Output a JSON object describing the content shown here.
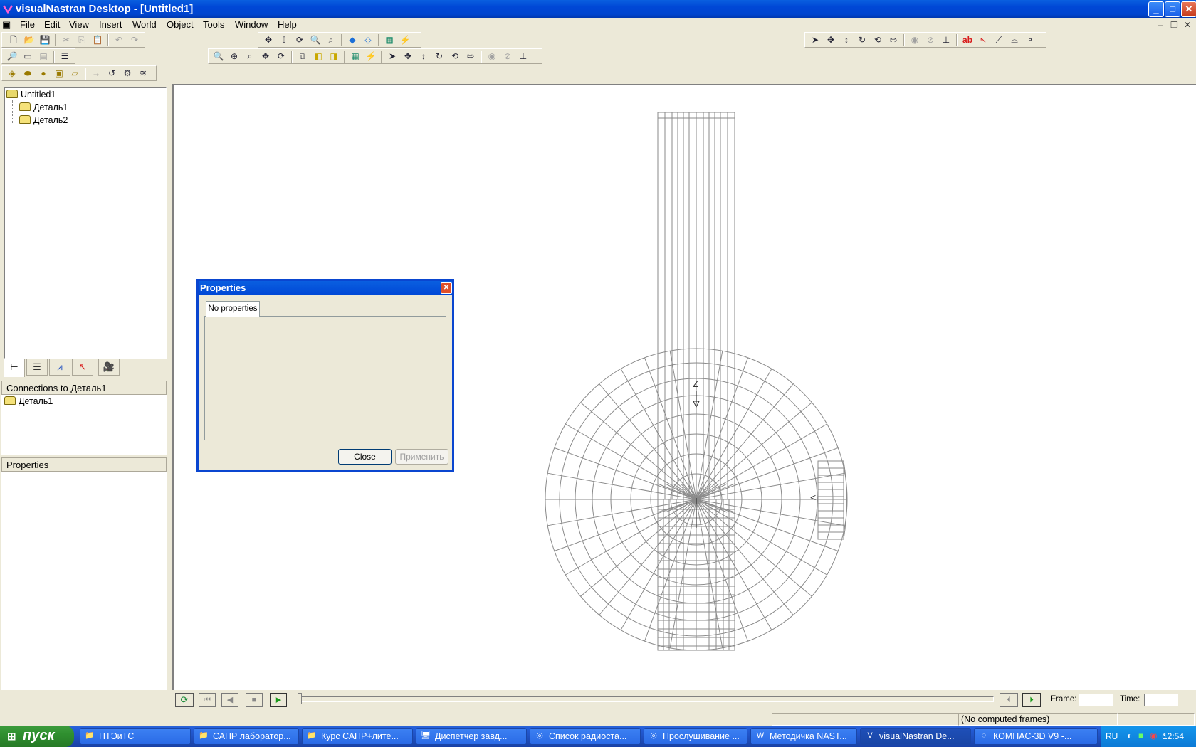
{
  "window": {
    "title": "visualNastran Desktop - [Untitled1]",
    "minimize_label": "_",
    "maximize_label": "□",
    "close_label": "✕"
  },
  "menubar": {
    "items": [
      "File",
      "Edit",
      "View",
      "Insert",
      "World",
      "Object",
      "Tools",
      "Window",
      "Help"
    ],
    "mdi_min": "–",
    "mdi_restore": "❐",
    "mdi_close": "✕"
  },
  "tree": {
    "root": "Untitled1",
    "children": [
      "Деталь1",
      "Деталь2"
    ]
  },
  "panel_tabs": [
    "tree-view",
    "list-view",
    "graph-view",
    "constraint-view",
    "movie-view"
  ],
  "connections": {
    "header": "Connections to Деталь1",
    "items": [
      "Деталь1"
    ]
  },
  "properties_pane": {
    "header": "Properties"
  },
  "dialog": {
    "title": "Properties",
    "tab_label": "No properties",
    "close_button": "Close",
    "apply_button": "Применить"
  },
  "viewport": {
    "axis_label": "Z"
  },
  "sim_controls": {
    "frame_label": "Frame:",
    "time_label": "Time:",
    "frame_value": "",
    "time_value": ""
  },
  "statusbar": {
    "message": "(No computed frames)"
  },
  "taskbar": {
    "start_label": "пуск",
    "tasks": [
      {
        "label": "ПТЭиТС",
        "icon": "folder-icon"
      },
      {
        "label": "САПР лаборатор...",
        "icon": "folder-icon"
      },
      {
        "label": "Курс САПР+лите...",
        "icon": "folder-icon"
      },
      {
        "label": "Диспетчер завд...",
        "icon": "task-manager-icon"
      },
      {
        "label": "Список радиоста...",
        "icon": "chrome-icon"
      },
      {
        "label": "Прослушивание ...",
        "icon": "chrome-icon"
      },
      {
        "label": "Методичка NAST...",
        "icon": "word-icon"
      },
      {
        "label": "visualNastran De...",
        "icon": "vn-icon"
      },
      {
        "label": "КОМПАС-3D V9 -...",
        "icon": "kompas-icon"
      }
    ],
    "language": "RU",
    "clock": "12:54"
  }
}
